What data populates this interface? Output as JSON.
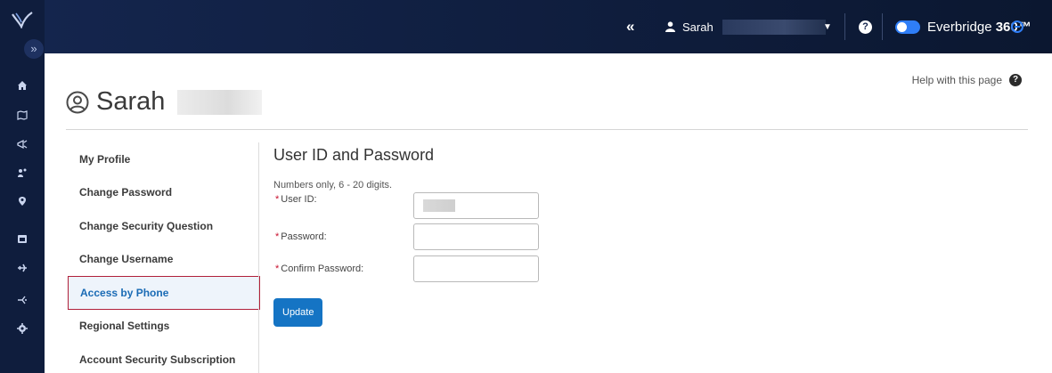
{
  "rail": {
    "expand_glyph": "»",
    "icons": [
      "home-icon",
      "map-icon",
      "megaphone-icon",
      "people-icon",
      "location-pin-icon",
      "calendar-icon",
      "plane-icon",
      "merge-icon",
      "settings-icon"
    ]
  },
  "topbar": {
    "collapse_glyph": "«",
    "user_name": "Sarah",
    "brand_name": "Everbridge",
    "brand_suffix": "360™",
    "help_glyph": "?"
  },
  "page": {
    "user_name": "Sarah",
    "help_label": "Help with this page",
    "help_glyph": "?"
  },
  "menu": {
    "items": [
      "My Profile",
      "Change Password",
      "Change Security Question",
      "Change Username",
      "Access by Phone",
      "Regional Settings",
      "Account Security Subscription"
    ],
    "active_index": 4
  },
  "form": {
    "title": "User ID and Password",
    "hint": "Numbers only, 6 - 20 digits.",
    "required_mark": "*",
    "user_id_label": "User ID:",
    "password_label": "Password:",
    "confirm_label": "Confirm Password:",
    "update_label": "Update"
  },
  "colors": {
    "accent": "#1574c4",
    "active_border": "#b0203a",
    "nav_bg": "#0f1d3d",
    "toggle": "#2f7ef7"
  }
}
